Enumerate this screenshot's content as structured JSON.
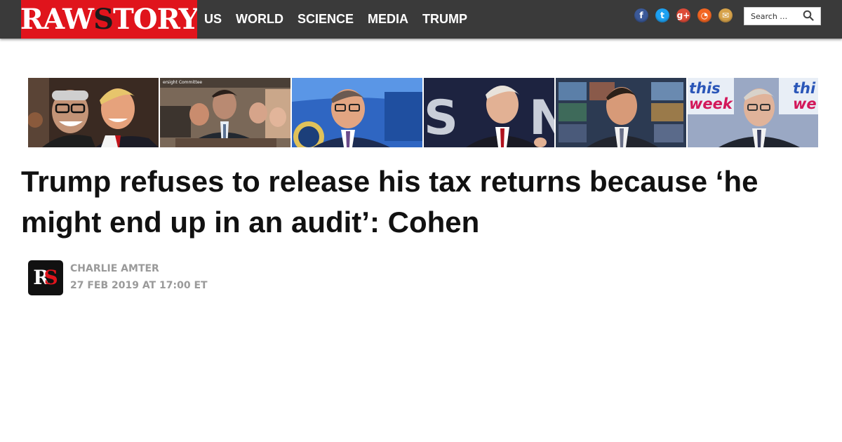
{
  "header": {
    "logo_text": "RAWSTORY",
    "nav_items": [
      "US",
      "WORLD",
      "SCIENCE",
      "MEDIA",
      "TRUMP"
    ],
    "social_icons": [
      {
        "name": "facebook-icon",
        "glyph": "f",
        "color": "#3b5998"
      },
      {
        "name": "twitter-icon",
        "glyph": "t",
        "color": "#1da1f2"
      },
      {
        "name": "google-plus-icon",
        "glyph": "g+",
        "color": "#dd4b39"
      },
      {
        "name": "rss-icon",
        "glyph": "◔",
        "color": "#f26522"
      },
      {
        "name": "email-icon",
        "glyph": "✉",
        "color": "#d6a24a"
      }
    ],
    "search_placeholder": "Search …"
  },
  "thumbnails": {
    "thumb_2_caption": "ersight Committee",
    "thumb_5_text_left": "this",
    "thumb_5_text_left_2": "week",
    "thumb_5_text_right": "thi",
    "thumb_5_text_right_2": "we"
  },
  "article": {
    "headline": "Trump refuses to release his tax returns because ‘he might end up in an audit’: Cohen",
    "author": "Charlie Amter",
    "date": "27 FEB 2019 AT 17:00 ET",
    "avatar_text_1": "R",
    "avatar_text_2": "S"
  },
  "colors": {
    "brand_red": "#e0141c",
    "header_bg": "#3a3a3a",
    "byline_gray": "#9a9a9a"
  }
}
